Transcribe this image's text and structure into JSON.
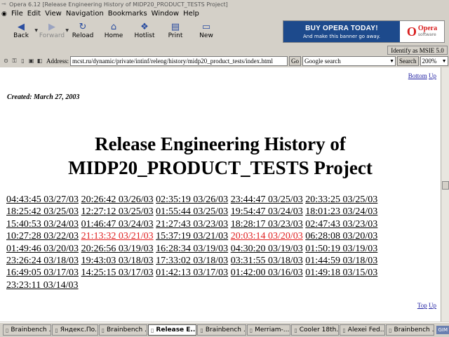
{
  "window": {
    "title": "Opera 6.12  [Release Engineering History of MIDP20_PRODUCT_TESTS Project]"
  },
  "menu": [
    {
      "label": "File",
      "key": "F"
    },
    {
      "label": "Edit",
      "key": "E"
    },
    {
      "label": "View",
      "key": "V"
    },
    {
      "label": "Navigation",
      "key": "N"
    },
    {
      "label": "Bookmarks",
      "key": "B"
    },
    {
      "label": "Window",
      "key": "W"
    },
    {
      "label": "Help",
      "key": "H"
    }
  ],
  "toolbar": {
    "back": "Back",
    "forward": "Forward",
    "reload": "Reload",
    "home": "Home",
    "hotlist": "Hotlist",
    "print": "Print",
    "new": "New"
  },
  "banner": {
    "headline": "BUY OPERA TODAY!",
    "subline": "And make this banner go away.",
    "logo_name": "Opera",
    "logo_sub": "software"
  },
  "identify": "Identify as MSIE 5.0",
  "address": {
    "label": "Address:",
    "value": "mcst.ru/dynamic/private/intinf/releng/history/midp20_product_tests/index.html",
    "go": "Go",
    "search_engine": "Google search",
    "search_button": "Search",
    "zoom": "200%"
  },
  "page": {
    "nav_bottom": "Bottom",
    "nav_up": "Up",
    "nav_top": "Top",
    "created": "Created: March 27, 2003",
    "heading_line1": "Release Engineering History of",
    "heading_line2": "MIDP20_PRODUCT_TESTS Project",
    "entries": [
      {
        "text": "04:43:45 03/27/03",
        "visited": false
      },
      {
        "text": "20:26:42 03/26/03",
        "visited": false
      },
      {
        "text": "02:35:19 03/26/03",
        "visited": false
      },
      {
        "text": "23:44:47 03/25/03",
        "visited": false
      },
      {
        "text": "20:33:25 03/25/03",
        "visited": false
      },
      {
        "text": "18:25:42 03/25/03",
        "visited": false
      },
      {
        "text": "12:27:12 03/25/03",
        "visited": false
      },
      {
        "text": "01:55:44 03/25/03",
        "visited": false
      },
      {
        "text": "19:54:47 03/24/03",
        "visited": false
      },
      {
        "text": "18:01:23 03/24/03",
        "visited": false
      },
      {
        "text": "15:40:53 03/24/03",
        "visited": false
      },
      {
        "text": "01:46:47 03/24/03",
        "visited": false
      },
      {
        "text": "21:27:43 03/23/03",
        "visited": false
      },
      {
        "text": "18:28:17 03/23/03",
        "visited": false
      },
      {
        "text": "02:47:43 03/23/03",
        "visited": false
      },
      {
        "text": "10:27:28 03/22/03",
        "visited": false
      },
      {
        "text": "21:13:32 03/21/03",
        "visited": true
      },
      {
        "text": "15:37:19 03/21/03",
        "visited": false
      },
      {
        "text": "20:03:14 03/20/03",
        "visited": true
      },
      {
        "text": "06:28:08 03/20/03",
        "visited": false
      },
      {
        "text": "01:49:46 03/20/03",
        "visited": false
      },
      {
        "text": "20:26:56 03/19/03",
        "visited": false
      },
      {
        "text": "16:28:34 03/19/03",
        "visited": false
      },
      {
        "text": "04:30:20 03/19/03",
        "visited": false
      },
      {
        "text": "01:50:19 03/19/03",
        "visited": false
      },
      {
        "text": "23:26:24 03/18/03",
        "visited": false
      },
      {
        "text": "19:43:03 03/18/03",
        "visited": false
      },
      {
        "text": "17:33:02 03/18/03",
        "visited": false
      },
      {
        "text": "03:31:55 03/18/03",
        "visited": false
      },
      {
        "text": "01:44:59 03/18/03",
        "visited": false
      },
      {
        "text": "16:49:05 03/17/03",
        "visited": false
      },
      {
        "text": "14:25:15 03/17/03",
        "visited": false
      },
      {
        "text": "01:42:13 03/17/03",
        "visited": false
      },
      {
        "text": "01:42:00 03/16/03",
        "visited": false
      },
      {
        "text": "01:49:18 03/15/03",
        "visited": false
      },
      {
        "text": "23:23:11 03/14/03",
        "visited": false
      }
    ]
  },
  "tabs": [
    {
      "label": "Brainbench ...",
      "active": false
    },
    {
      "label": "Яндекс.По...",
      "active": false
    },
    {
      "label": "Brainbench ...",
      "active": false
    },
    {
      "label": "Release E....",
      "active": true
    },
    {
      "label": "Brainbench ...",
      "active": false
    },
    {
      "label": "Merriam-.....",
      "active": false
    },
    {
      "label": "Cooler 18th...",
      "active": false
    },
    {
      "label": "Alexei Fed....",
      "active": false
    },
    {
      "label": "Brainbench ...",
      "active": false
    }
  ],
  "tray_label": "GIM",
  "colors": {
    "visited_link": "#e02020",
    "banner_bg": "#1d4a8c",
    "chrome": "#d4d0c8"
  }
}
